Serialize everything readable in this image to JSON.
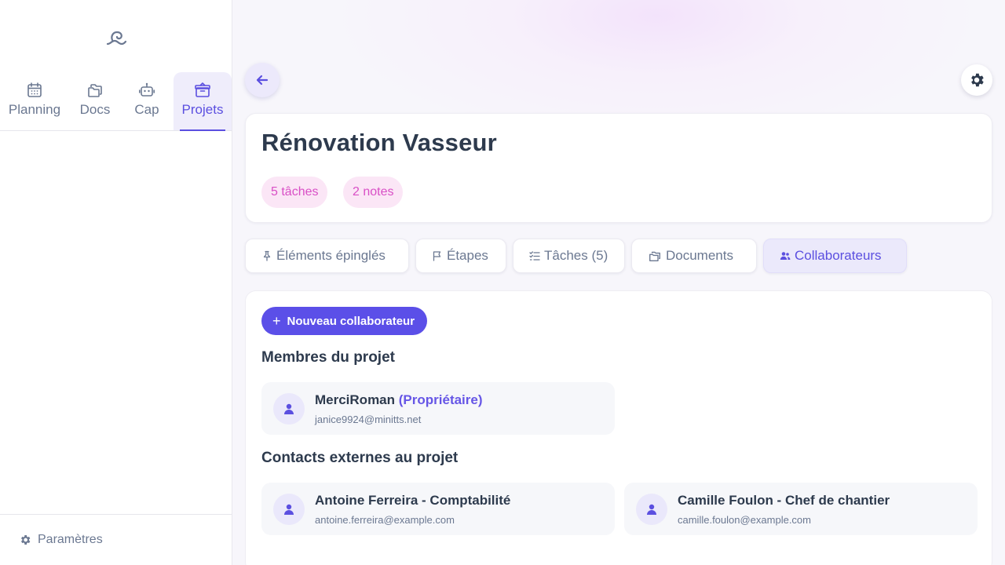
{
  "sidebar": {
    "nav": [
      {
        "label": "Planning",
        "icon": "calendar-icon"
      },
      {
        "label": "Docs",
        "icon": "folders-icon"
      },
      {
        "label": "Cap",
        "icon": "robot-icon"
      },
      {
        "label": "Projets",
        "icon": "box-icon",
        "active": true
      }
    ],
    "settings_label": "Paramètres"
  },
  "project": {
    "title": "Rénovation Vasseur",
    "badges": [
      "5 tâches",
      "2 notes"
    ]
  },
  "tabs": [
    {
      "label": "Éléments épinglés",
      "icon": "pin-icon"
    },
    {
      "label": "Étapes",
      "icon": "flag-icon"
    },
    {
      "label": "Tâches (5)",
      "icon": "list-check-icon"
    },
    {
      "label": "Documents",
      "icon": "folders-icon"
    },
    {
      "label": "Collaborateurs",
      "icon": "users-icon",
      "active": true
    }
  ],
  "collaborators": {
    "new_button": "Nouveau collaborateur",
    "members_title": "Membres du projet",
    "members": [
      {
        "name": "MerciRoman",
        "role": "(Propriétaire)",
        "email": "janice9924@minitts.net"
      }
    ],
    "external_title": "Contacts externes au projet",
    "external": [
      {
        "name": "Antoine Ferreira - Comptabilité",
        "email": "antoine.ferreira@example.com"
      },
      {
        "name": "Camille Foulon - Chef de chantier",
        "email": "camille.foulon@example.com"
      }
    ]
  },
  "colors": {
    "accent": "#5b4fe0",
    "badge_bg": "#fbe6f6",
    "badge_text": "#d94fc6"
  }
}
